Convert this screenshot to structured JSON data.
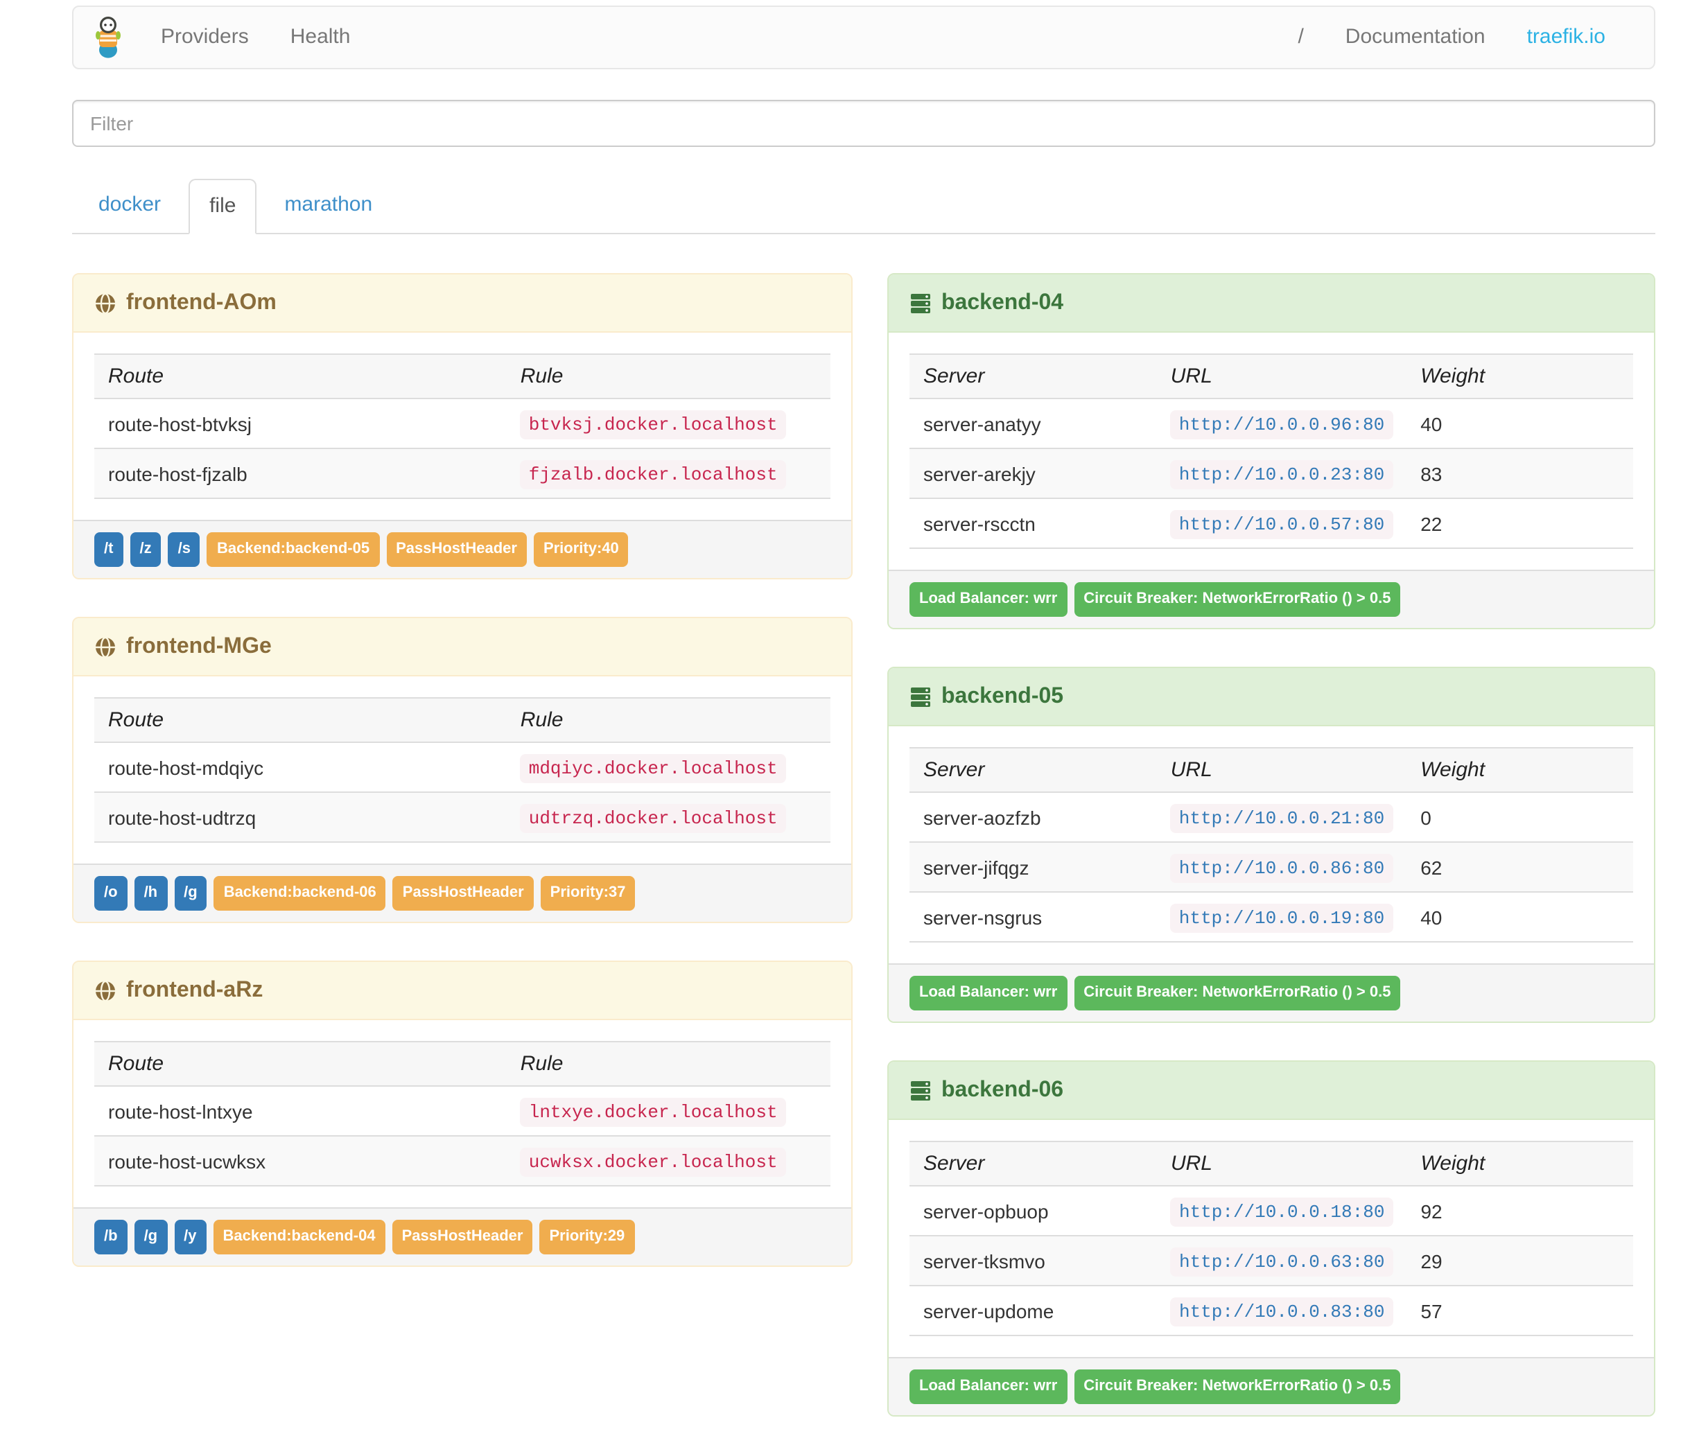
{
  "navbar": {
    "brand_icon": "traefik-logo",
    "left_links": [
      {
        "label": "Providers"
      },
      {
        "label": "Health"
      }
    ],
    "right_links": [
      {
        "label": "/"
      },
      {
        "label": "Documentation"
      },
      {
        "label": "traefik.io",
        "highlight": true
      }
    ]
  },
  "filter": {
    "placeholder": "Filter"
  },
  "tabs": [
    {
      "label": "docker",
      "active": false
    },
    {
      "label": "file",
      "active": true
    },
    {
      "label": "marathon",
      "active": false
    }
  ],
  "frontends": {
    "columns": [
      "Route",
      "Rule"
    ],
    "panels": [
      {
        "name": "frontend-AOm",
        "icon": "globe-icon",
        "routes": [
          {
            "route": "route-host-btvksj",
            "rule": "btvksj.docker.localhost"
          },
          {
            "route": "route-host-fjzalb",
            "rule": "fjzalb.docker.localhost"
          }
        ],
        "entrypoint_badges": [
          "/t",
          "/z",
          "/s"
        ],
        "setting_badges": [
          "Backend:backend-05",
          "PassHostHeader",
          "Priority:40"
        ]
      },
      {
        "name": "frontend-MGe",
        "icon": "globe-icon",
        "routes": [
          {
            "route": "route-host-mdqiyc",
            "rule": "mdqiyc.docker.localhost"
          },
          {
            "route": "route-host-udtrzq",
            "rule": "udtrzq.docker.localhost"
          }
        ],
        "entrypoint_badges": [
          "/o",
          "/h",
          "/g"
        ],
        "setting_badges": [
          "Backend:backend-06",
          "PassHostHeader",
          "Priority:37"
        ]
      },
      {
        "name": "frontend-aRz",
        "icon": "globe-icon",
        "routes": [
          {
            "route": "route-host-lntxye",
            "rule": "lntxye.docker.localhost"
          },
          {
            "route": "route-host-ucwksx",
            "rule": "ucwksx.docker.localhost"
          }
        ],
        "entrypoint_badges": [
          "/b",
          "/g",
          "/y"
        ],
        "setting_badges": [
          "Backend:backend-04",
          "PassHostHeader",
          "Priority:29"
        ]
      }
    ]
  },
  "backends": {
    "columns": [
      "Server",
      "URL",
      "Weight"
    ],
    "panels": [
      {
        "name": "backend-04",
        "icon": "server-icon",
        "servers": [
          {
            "server": "server-anatyy",
            "url": "http://10.0.0.96:80",
            "weight": "40"
          },
          {
            "server": "server-arekjy",
            "url": "http://10.0.0.23:80",
            "weight": "83"
          },
          {
            "server": "server-rscctn",
            "url": "http://10.0.0.57:80",
            "weight": "22"
          }
        ],
        "badges": [
          "Load Balancer: wrr",
          "Circuit Breaker: NetworkErrorRatio () > 0.5"
        ]
      },
      {
        "name": "backend-05",
        "icon": "server-icon",
        "servers": [
          {
            "server": "server-aozfzb",
            "url": "http://10.0.0.21:80",
            "weight": "0"
          },
          {
            "server": "server-jifqgz",
            "url": "http://10.0.0.86:80",
            "weight": "62"
          },
          {
            "server": "server-nsgrus",
            "url": "http://10.0.0.19:80",
            "weight": "40"
          }
        ],
        "badges": [
          "Load Balancer: wrr",
          "Circuit Breaker: NetworkErrorRatio () > 0.5"
        ]
      },
      {
        "name": "backend-06",
        "icon": "server-icon",
        "servers": [
          {
            "server": "server-opbuop",
            "url": "http://10.0.0.18:80",
            "weight": "92"
          },
          {
            "server": "server-tksmvo",
            "url": "http://10.0.0.63:80",
            "weight": "29"
          },
          {
            "server": "server-updome",
            "url": "http://10.0.0.83:80",
            "weight": "57"
          }
        ],
        "badges": [
          "Load Balancer: wrr",
          "Circuit Breaker: NetworkErrorRatio () > 0.5"
        ]
      }
    ]
  },
  "colors": {
    "badge_primary": "#337ab7",
    "badge_warning": "#f0ad4e",
    "badge_success": "#5cb85c",
    "frontend_heading_bg": "#fcf8e3",
    "frontend_heading_text": "#8a6d3b",
    "backend_heading_bg": "#dff0d8",
    "backend_heading_text": "#3c763d",
    "rule_code_text": "#c7254e",
    "url_code_text": "#337ab7",
    "tab_link": "#3e8fc9",
    "brand_link": "#2cb2e4"
  }
}
